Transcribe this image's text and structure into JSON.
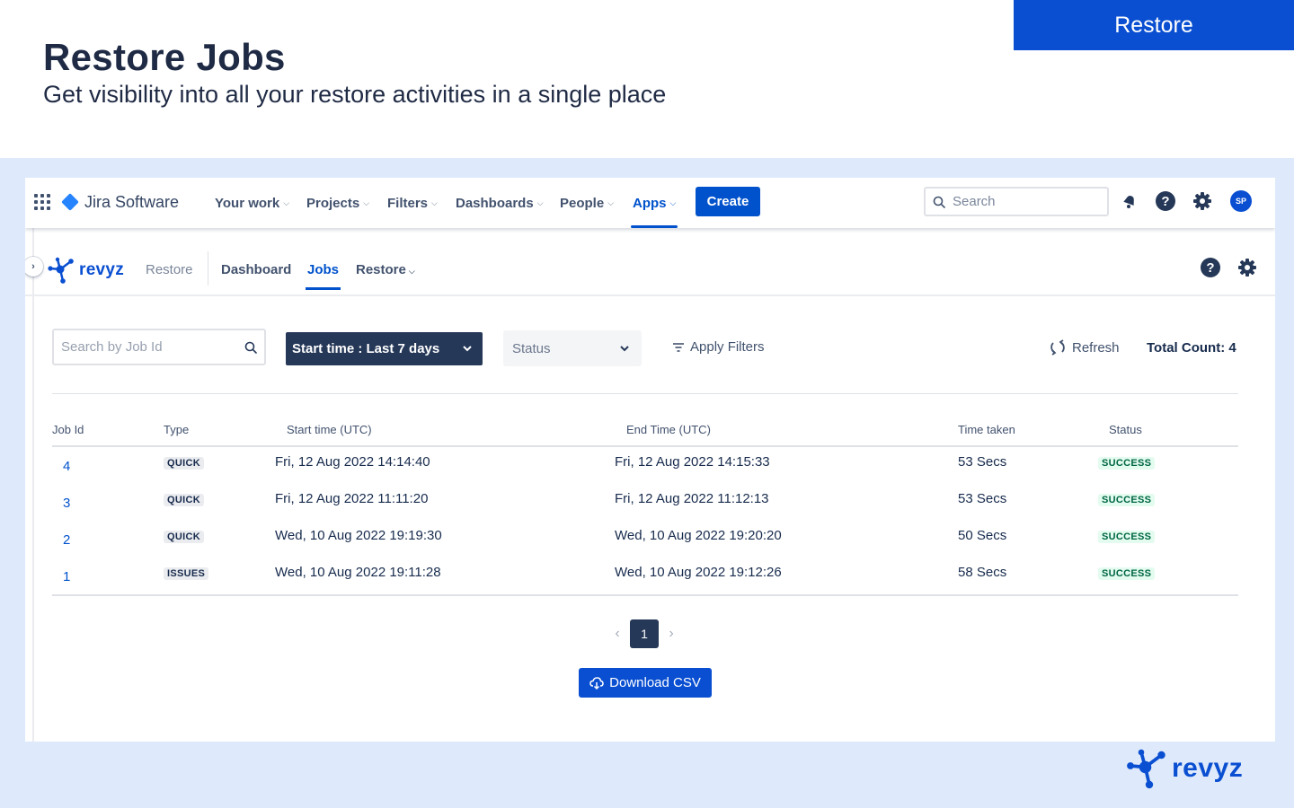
{
  "banner": {
    "title": "Restore Jobs",
    "subtitle": "Get visibility into all your restore activities in a single place",
    "tag": "Restore"
  },
  "jira": {
    "product_name": "Jira Software",
    "nav": [
      {
        "label": "Your work",
        "active": false
      },
      {
        "label": "Projects",
        "active": false
      },
      {
        "label": "Filters",
        "active": false
      },
      {
        "label": "Dashboards",
        "active": false
      },
      {
        "label": "People",
        "active": false
      },
      {
        "label": "Apps",
        "active": true
      }
    ],
    "create_label": "Create",
    "search_placeholder": "Search",
    "avatar_initials": "SP",
    "icons": [
      "app-switcher-icon",
      "notifications-icon",
      "help-icon",
      "settings-icon"
    ]
  },
  "revyz_nav": {
    "brand": "revyz",
    "section": "Restore",
    "tabs": [
      {
        "label": "Dashboard",
        "active": false
      },
      {
        "label": "Jobs",
        "active": true
      },
      {
        "label": "Restore",
        "active": false,
        "dropdown": true
      }
    ]
  },
  "filters": {
    "job_search_placeholder": "Search by Job Id",
    "start_time": "Start time : Last 7 days",
    "status_placeholder": "Status",
    "apply_label": "Apply Filters",
    "refresh_label": "Refresh",
    "total_count": "Total Count: 4"
  },
  "table": {
    "columns": [
      "Job Id",
      "Type",
      "Start time (UTC)",
      "End Time (UTC)",
      "Time taken",
      "Status"
    ],
    "rows": [
      {
        "id": "4",
        "type": "QUICK",
        "start": "Fri, 12 Aug 2022 14:14:40",
        "end": "Fri, 12 Aug 2022 14:15:33",
        "taken": "53 Secs",
        "status": "SUCCESS"
      },
      {
        "id": "3",
        "type": "QUICK",
        "start": "Fri, 12 Aug 2022 11:11:20",
        "end": "Fri, 12 Aug 2022 11:12:13",
        "taken": "53 Secs",
        "status": "SUCCESS"
      },
      {
        "id": "2",
        "type": "QUICK",
        "start": "Wed, 10 Aug 2022 19:19:30",
        "end": "Wed, 10 Aug 2022 19:20:20",
        "taken": "50 Secs",
        "status": "SUCCESS"
      },
      {
        "id": "1",
        "type": "ISSUES",
        "start": "Wed, 10 Aug 2022 19:11:28",
        "end": "Wed, 10 Aug 2022 19:12:26",
        "taken": "58 Secs",
        "status": "SUCCESS"
      }
    ]
  },
  "pagination": {
    "current_page": "1"
  },
  "download_label": "Download CSV",
  "footer_brand": "revyz",
  "colors": {
    "brand_blue": "#0a4fd1",
    "jira_blue": "#0052cc",
    "backdrop": "#deeafb",
    "dark_navy": "#253858"
  }
}
